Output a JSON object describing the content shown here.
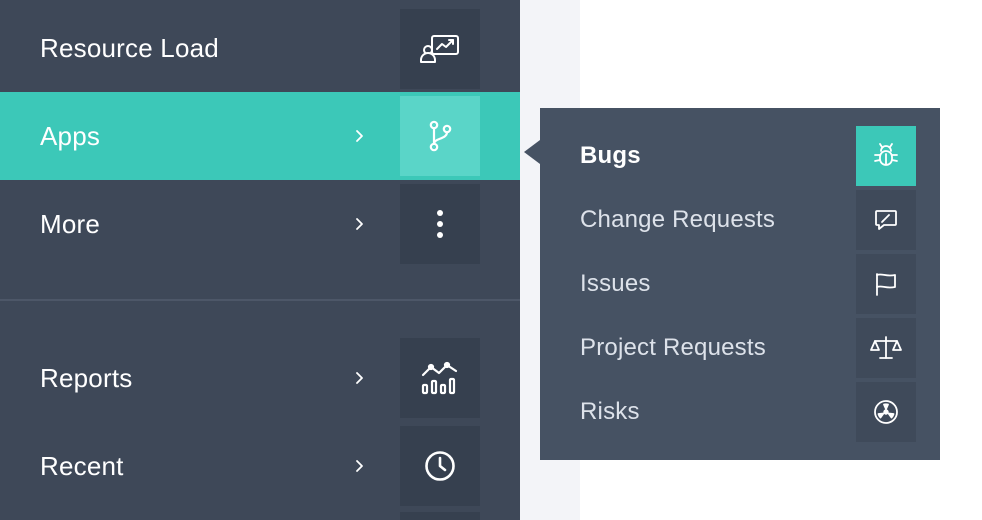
{
  "sidebar": {
    "items": [
      {
        "label": "Resource Load",
        "icon": "resource-load-icon"
      },
      {
        "label": "Apps",
        "icon": "branch-icon",
        "active": true
      },
      {
        "label": "More",
        "icon": "more-vertical-icon"
      },
      {
        "label": "Reports",
        "icon": "reports-chart-icon"
      },
      {
        "label": "Recent",
        "icon": "clock-icon"
      }
    ]
  },
  "flyout": {
    "items": [
      {
        "label": "Bugs",
        "icon": "bug-icon",
        "active": true
      },
      {
        "label": "Change Requests",
        "icon": "edit-message-icon"
      },
      {
        "label": "Issues",
        "icon": "flag-icon"
      },
      {
        "label": "Project Requests",
        "icon": "scale-icon"
      },
      {
        "label": "Risks",
        "icon": "radiation-icon"
      }
    ]
  },
  "colors": {
    "sidebar_bg": "#3e4858",
    "accent": "#3cc8b8",
    "flyout_bg": "#465263",
    "gutter": "#f3f4f8"
  }
}
